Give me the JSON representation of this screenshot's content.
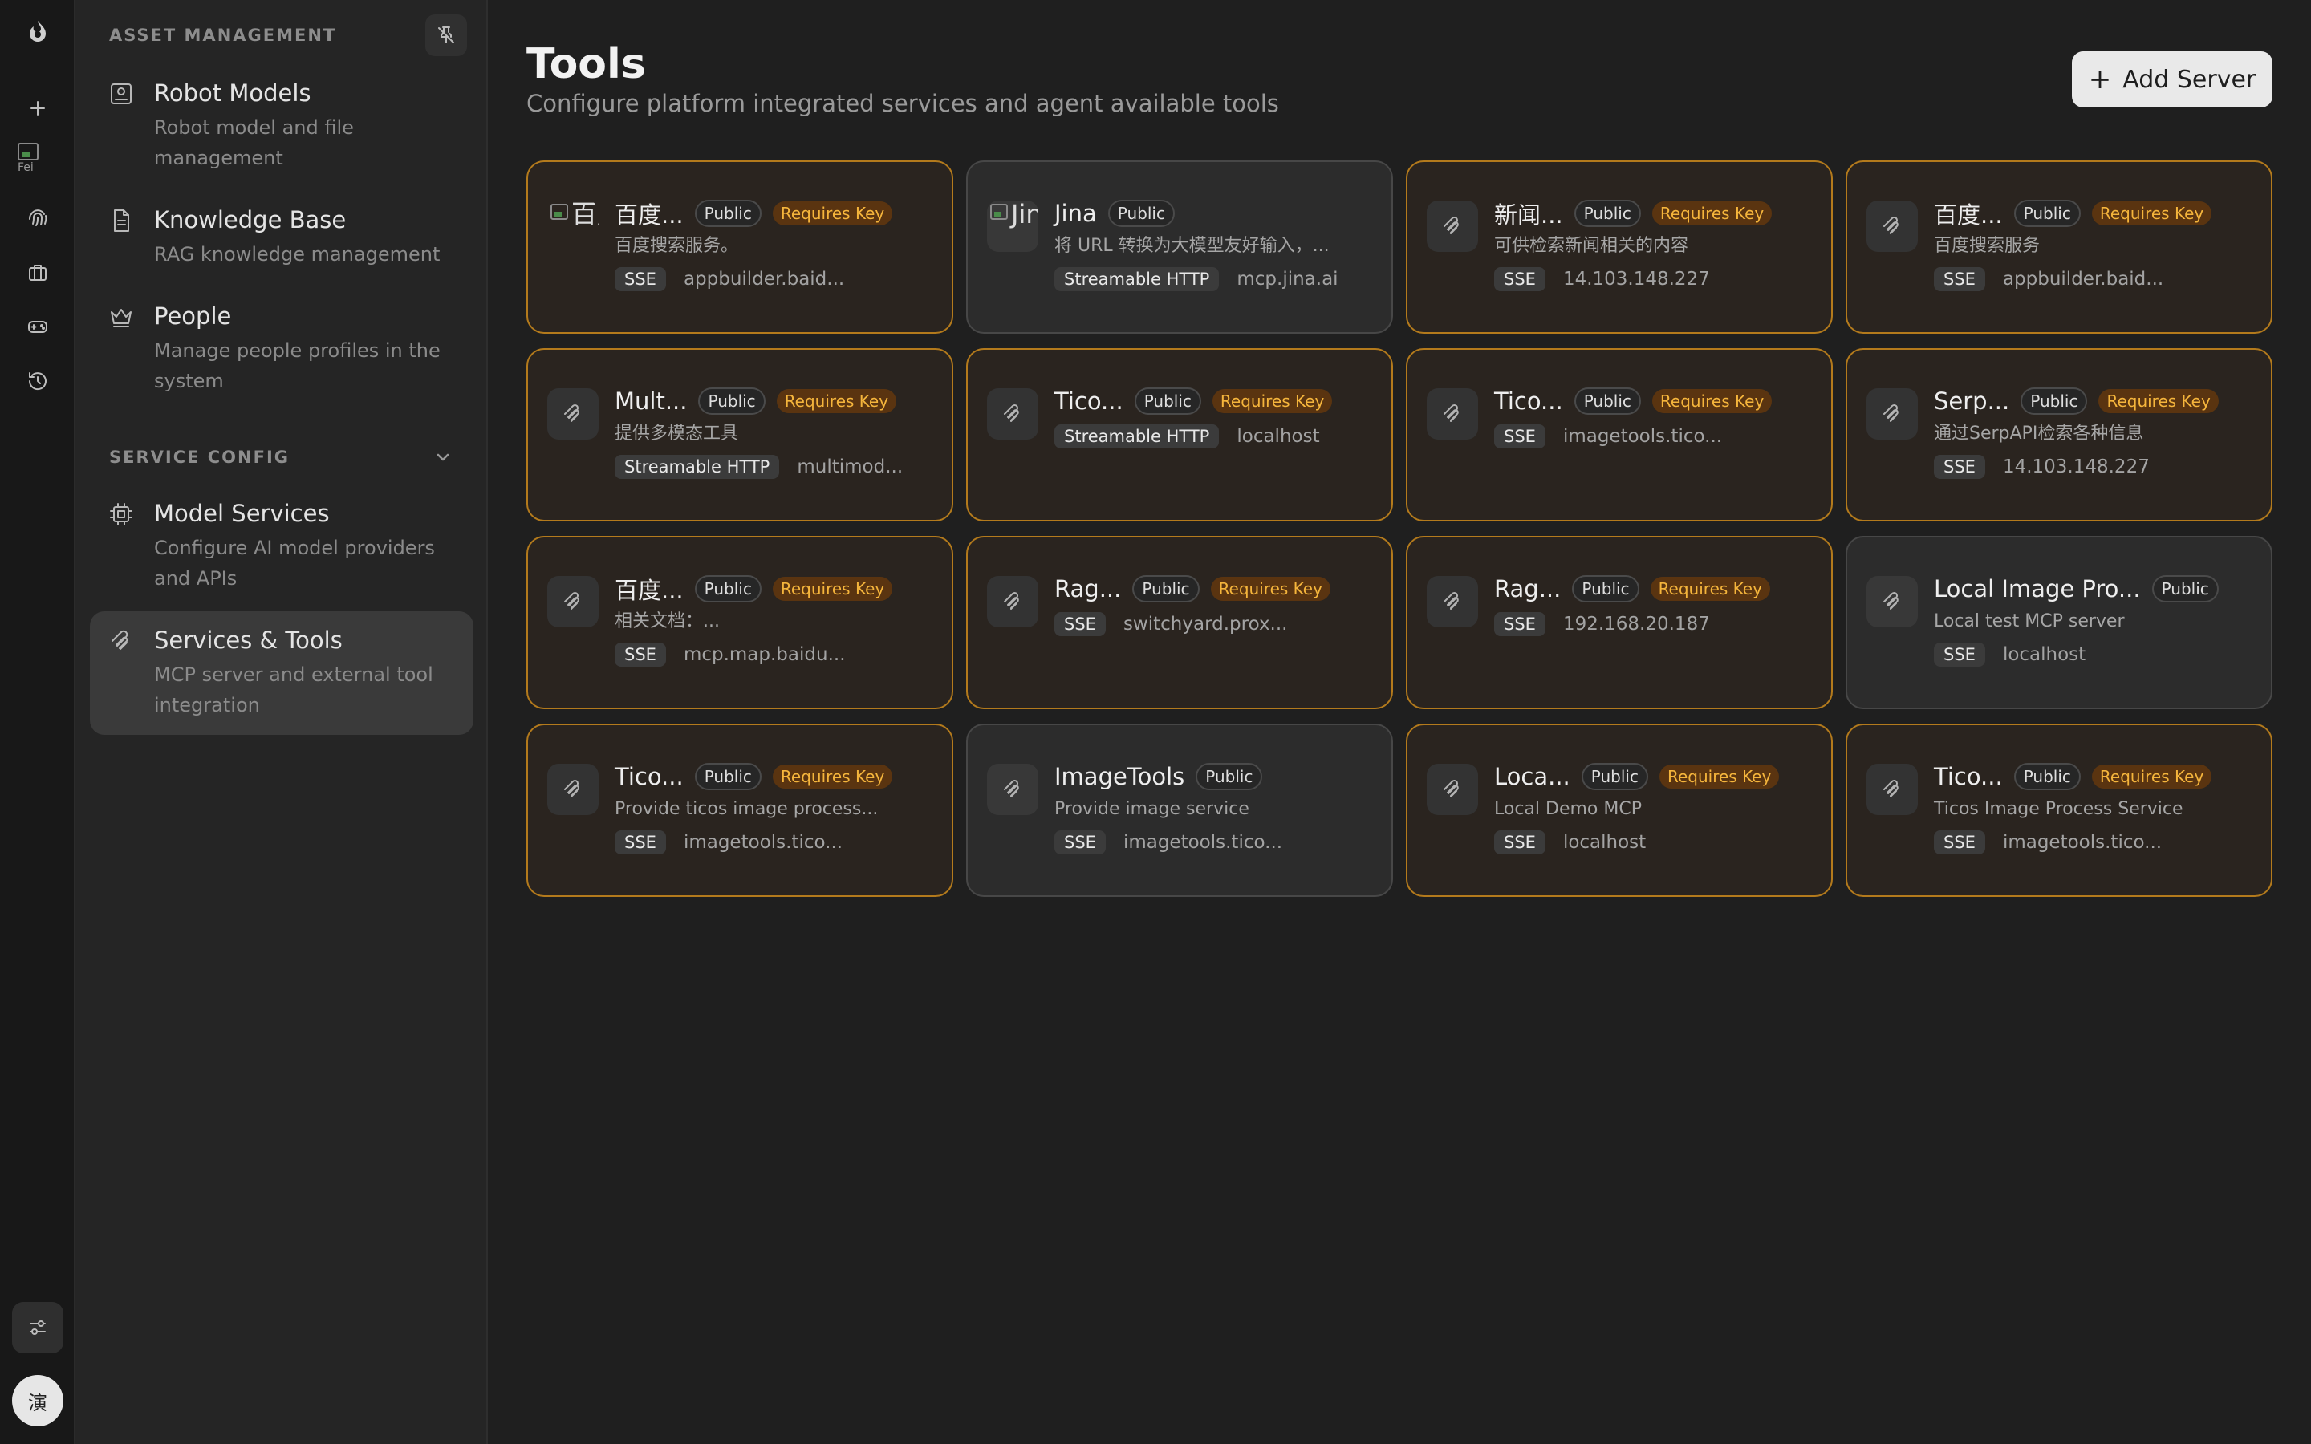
{
  "sidebar": {
    "asset_title": "ASSET MANAGEMENT",
    "service_title": "SERVICE CONFIG",
    "items": [
      {
        "title": "Robot Models",
        "desc": "Robot model and file management"
      },
      {
        "title": "Knowledge Base",
        "desc": "RAG knowledge management"
      },
      {
        "title": "People",
        "desc": "Manage people profiles in the system"
      },
      {
        "title": "Model Services",
        "desc": "Configure AI model providers and APIs"
      },
      {
        "title": "Services & Tools",
        "desc": "MCP server and external tool integration"
      }
    ]
  },
  "rail": {
    "image_alt": "Fei",
    "avatar_text": "演"
  },
  "header": {
    "title": "Tools",
    "subtitle": "Configure platform integrated services and agent available tools",
    "add_label": "Add Server"
  },
  "colors": {
    "accent_border": "#b37a1c",
    "key_badge_text": "#f5b53c"
  },
  "cards": [
    {
      "name": "百度...",
      "public": "Public",
      "key": "Requires Key",
      "desc": "百度搜索服务。",
      "protocol": "SSE",
      "host": "appbuilder.baid...",
      "icon_alt": "百度"
    },
    {
      "name": "Jina",
      "public": "Public",
      "desc": "将 URL 转换为大模型友好输入，...",
      "protocol": "Streamable HTTP",
      "host": "mcp.jina.ai",
      "icon_alt": "Jina"
    },
    {
      "name": "新闻...",
      "public": "Public",
      "key": "Requires Key",
      "desc": "可供检索新闻相关的内容",
      "protocol": "SSE",
      "host": "14.103.148.227"
    },
    {
      "name": "百度...",
      "public": "Public",
      "key": "Requires Key",
      "desc": "百度搜索服务",
      "protocol": "SSE",
      "host": "appbuilder.baid..."
    },
    {
      "name": "Mult...",
      "public": "Public",
      "key": "Requires Key",
      "desc": "提供多模态工具",
      "protocol": "Streamable HTTP",
      "host": "multimod..."
    },
    {
      "name": "Tico...",
      "public": "Public",
      "key": "Requires Key",
      "desc": "",
      "protocol": "Streamable HTTP",
      "host": "localhost"
    },
    {
      "name": "Tico...",
      "public": "Public",
      "key": "Requires Key",
      "desc": "",
      "protocol": "SSE",
      "host": "imagetools.tico..."
    },
    {
      "name": "Serp...",
      "public": "Public",
      "key": "Requires Key",
      "desc": "通过SerpAPI检索各种信息",
      "protocol": "SSE",
      "host": "14.103.148.227"
    },
    {
      "name": "百度...",
      "public": "Public",
      "key": "Requires Key",
      "desc": "相关文档：...",
      "protocol": "SSE",
      "host": "mcp.map.baidu..."
    },
    {
      "name": "Rag...",
      "public": "Public",
      "key": "Requires Key",
      "desc": "",
      "protocol": "SSE",
      "host": "switchyard.prox..."
    },
    {
      "name": "Rag...",
      "public": "Public",
      "key": "Requires Key",
      "desc": "",
      "protocol": "SSE",
      "host": "192.168.20.187"
    },
    {
      "name": "Local Image Pro...",
      "public": "Public",
      "desc": "Local test MCP server",
      "protocol": "SSE",
      "host": "localhost"
    },
    {
      "name": "Tico...",
      "public": "Public",
      "key": "Requires Key",
      "desc": "Provide ticos image process...",
      "protocol": "SSE",
      "host": "imagetools.tico..."
    },
    {
      "name": "ImageTools",
      "public": "Public",
      "desc": "Provide image service",
      "protocol": "SSE",
      "host": "imagetools.tico..."
    },
    {
      "name": "Loca...",
      "public": "Public",
      "key": "Requires Key",
      "desc": "Local Demo MCP",
      "protocol": "SSE",
      "host": "localhost"
    },
    {
      "name": "Tico...",
      "public": "Public",
      "key": "Requires Key",
      "desc": "Ticos Image Process Service",
      "protocol": "SSE",
      "host": "imagetools.tico..."
    }
  ]
}
